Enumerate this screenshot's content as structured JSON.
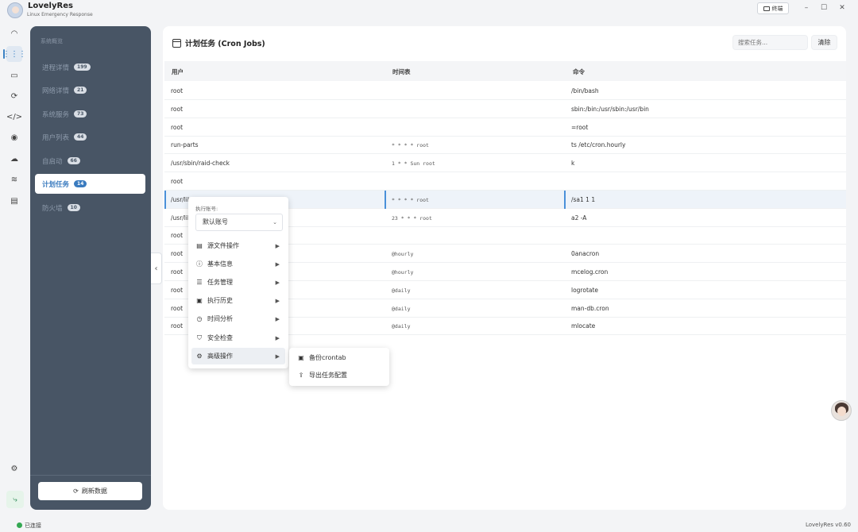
{
  "app": {
    "name": "LovelyRes",
    "subtitle": "Linux Emergency Response",
    "version": "LovelyRes v0.60"
  },
  "titlebar": {
    "terminal_label": "终端",
    "minimize": "–",
    "maximize": "☐",
    "close": "✕"
  },
  "sidebar": {
    "section": "系统概览",
    "items": [
      {
        "label": "进程详情",
        "count": "199"
      },
      {
        "label": "网络详情",
        "count": "21"
      },
      {
        "label": "系统服务",
        "count": "73"
      },
      {
        "label": "用户列表",
        "count": "44"
      },
      {
        "label": "自启动",
        "count": "66"
      },
      {
        "label": "计划任务",
        "count": "14"
      },
      {
        "label": "防火墙",
        "count": "10"
      }
    ],
    "refresh_label": "刷新数据"
  },
  "panel": {
    "title": "计划任务 (Cron Jobs)",
    "search_placeholder": "搜索任务...",
    "clear_label": "清除",
    "columns": [
      "用户",
      "时间表",
      "命令"
    ],
    "rows": [
      [
        "root",
        "",
        "/bin/bash"
      ],
      [
        "root",
        "",
        "sbin:/bin:/usr/sbin:/usr/bin"
      ],
      [
        "root",
        "",
        "=root"
      ],
      [
        "run-parts",
        "* * * * root",
        "ts /etc/cron.hourly"
      ],
      [
        "/usr/sbin/raid-check",
        "1 * * Sun root",
        "k"
      ],
      [
        "root",
        "",
        ""
      ],
      [
        "/usr/lib6",
        "* * * * root",
        "/sa1 1 1"
      ],
      [
        "/usr/lib6",
        "23 * * * root",
        "a2 -A"
      ],
      [
        "root",
        "",
        ""
      ],
      [
        "root",
        "@hourly",
        "0anacron"
      ],
      [
        "root",
        "@hourly",
        "mcelog.cron"
      ],
      [
        "root",
        "@daily",
        "logrotate"
      ],
      [
        "root",
        "@daily",
        "man-db.cron"
      ],
      [
        "root",
        "@daily",
        "mlocate"
      ]
    ]
  },
  "context_menu": {
    "account_label": "执行账号:",
    "account_value": "默认账号",
    "items": [
      {
        "label": "源文件操作",
        "icon": "file-icon"
      },
      {
        "label": "基本信息",
        "icon": "info-icon"
      },
      {
        "label": "任务管理",
        "icon": "sliders-icon"
      },
      {
        "label": "执行历史",
        "icon": "history-icon"
      },
      {
        "label": "时间分析",
        "icon": "clock-icon"
      },
      {
        "label": "安全检查",
        "icon": "shield-icon"
      },
      {
        "label": "高级操作",
        "icon": "gear-icon"
      }
    ],
    "submenu": [
      {
        "label": "备份crontab",
        "icon": "save-icon"
      },
      {
        "label": "导出任务配置",
        "icon": "export-icon"
      }
    ]
  },
  "statusbar": {
    "connection": "已连接"
  },
  "colors": {
    "accent": "#3a7bbf",
    "sidebar_bg": "#485565",
    "status_ok": "#34a853"
  }
}
